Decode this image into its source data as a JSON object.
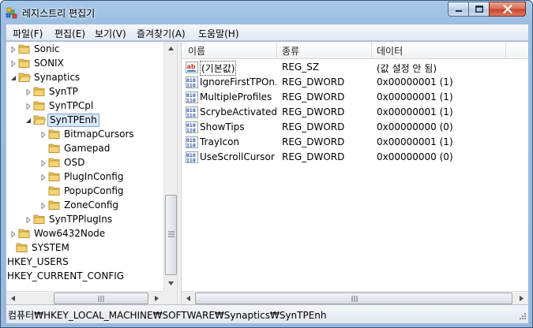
{
  "window": {
    "title": "레지스트리 편집기"
  },
  "menu": [
    {
      "label": "파일(F)"
    },
    {
      "label": "편집(E)"
    },
    {
      "label": "보기(V)"
    },
    {
      "label": "즐겨찾기(A)"
    },
    {
      "label": "도움말(H)"
    }
  ],
  "tree": [
    {
      "label": "Sonic",
      "level": 1,
      "expanded": false
    },
    {
      "label": "SONIX",
      "level": 1,
      "expanded": false
    },
    {
      "label": "Synaptics",
      "level": 1,
      "expanded": true
    },
    {
      "label": "SynTP",
      "level": 2,
      "expanded": false
    },
    {
      "label": "SynTPCpl",
      "level": 2,
      "expanded": false
    },
    {
      "label": "SynTPEnh",
      "level": 2,
      "expanded": true,
      "selected": true
    },
    {
      "label": "BitmapCursors",
      "level": 3,
      "expanded": false
    },
    {
      "label": "Gamepad",
      "level": 3,
      "expanded": null
    },
    {
      "label": "OSD",
      "level": 3,
      "expanded": false
    },
    {
      "label": "PlugInConfig",
      "level": 3,
      "expanded": false
    },
    {
      "label": "PopupConfig",
      "level": 3,
      "expanded": null
    },
    {
      "label": "ZoneConfig",
      "level": 3,
      "expanded": false
    },
    {
      "label": "SynTPPlugIns",
      "level": 2,
      "expanded": false
    },
    {
      "label": "Wow6432Node",
      "level": 1,
      "expanded": false
    },
    {
      "label": "SYSTEM",
      "level": 0,
      "expanded": null
    },
    {
      "label": "HKEY_USERS",
      "level": -1,
      "expanded": null
    },
    {
      "label": "HKEY_CURRENT_CONFIG",
      "level": -1,
      "expanded": null
    }
  ],
  "list": {
    "columns": {
      "name": "이름",
      "type": "종류",
      "data": "데이터"
    },
    "rows": [
      {
        "name": "(기본값)",
        "type": "REG_SZ",
        "data": "(값 설정 안 됨)",
        "icon": "string-value-icon",
        "focused": true
      },
      {
        "name": "IgnoreFirstTPOn...",
        "type": "REG_DWORD",
        "data": "0x00000001 (1)",
        "icon": "binary-value-icon"
      },
      {
        "name": "MultipleProfiles",
        "type": "REG_DWORD",
        "data": "0x00000001 (1)",
        "icon": "binary-value-icon"
      },
      {
        "name": "ScrybeActivated...",
        "type": "REG_DWORD",
        "data": "0x00000001 (1)",
        "icon": "binary-value-icon"
      },
      {
        "name": "ShowTips",
        "type": "REG_DWORD",
        "data": "0x00000000 (0)",
        "icon": "binary-value-icon"
      },
      {
        "name": "TrayIcon",
        "type": "REG_DWORD",
        "data": "0x00000001 (1)",
        "icon": "binary-value-icon"
      },
      {
        "name": "UseScrollCursor",
        "type": "REG_DWORD",
        "data": "0x00000000 (0)",
        "icon": "binary-value-icon"
      }
    ]
  },
  "status": {
    "path": "컴퓨터₩HKEY_LOCAL_MACHINE₩SOFTWARE₩Synaptics₩SynTPEnh"
  },
  "colors": {
    "folder": "#e8c15a",
    "selection": "#d9e8fb",
    "close_button": "#c8432a"
  }
}
